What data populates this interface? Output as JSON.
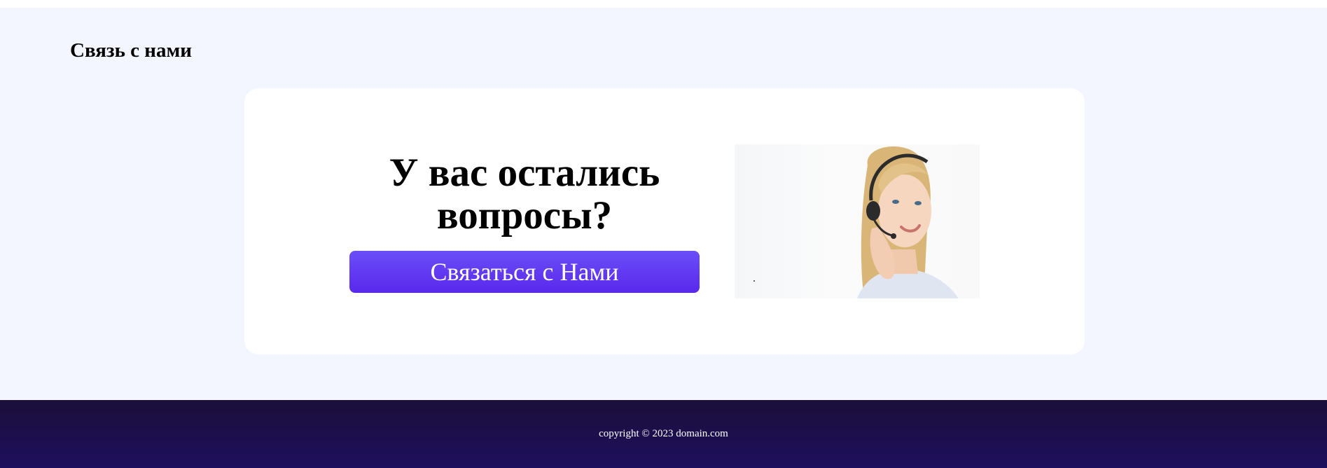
{
  "contact": {
    "section_title": "Связь с нами",
    "card": {
      "heading": "У вас остались вопросы?",
      "button_label": "Связаться с Нами"
    },
    "photo_icon": "support-operator-photo"
  },
  "footer": {
    "copyright": "copyright © 2023 domain.com"
  },
  "colors": {
    "section_background": "#f3f6fe",
    "card_background": "#ffffff",
    "button_gradient_start": "#6a4ef8",
    "button_gradient_end": "#5a28ec",
    "footer_background": "#1e0f5e"
  }
}
